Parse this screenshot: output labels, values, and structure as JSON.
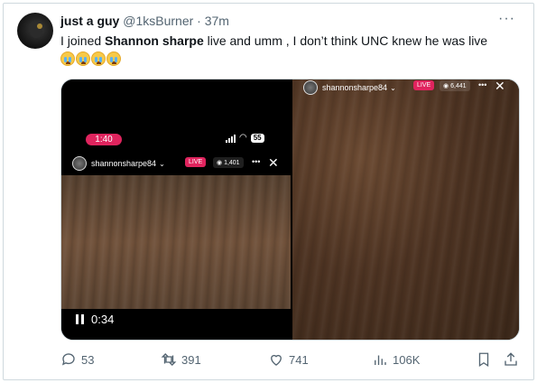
{
  "tweet": {
    "display_name": "just a guy",
    "handle": "@1ksBurner",
    "separator": "·",
    "time": "37m",
    "more": "···",
    "text_before": "I joined ",
    "text_bold": "Shannon sharpe",
    "text_after": " live and umm , I don’t think UNC knew he was live",
    "emoji_count": 4
  },
  "media": {
    "left": {
      "status_time": "1:40",
      "battery": "55",
      "username": "shannonsharpe84",
      "live_label": "LIVE",
      "viewers": "1,401",
      "player_time": "0:34"
    },
    "right": {
      "username": "shannonsharpe84",
      "live_label": "LIVE",
      "viewers": "6,441"
    }
  },
  "actions": {
    "replies": "53",
    "retweets": "391",
    "likes": "741",
    "views": "106K"
  }
}
